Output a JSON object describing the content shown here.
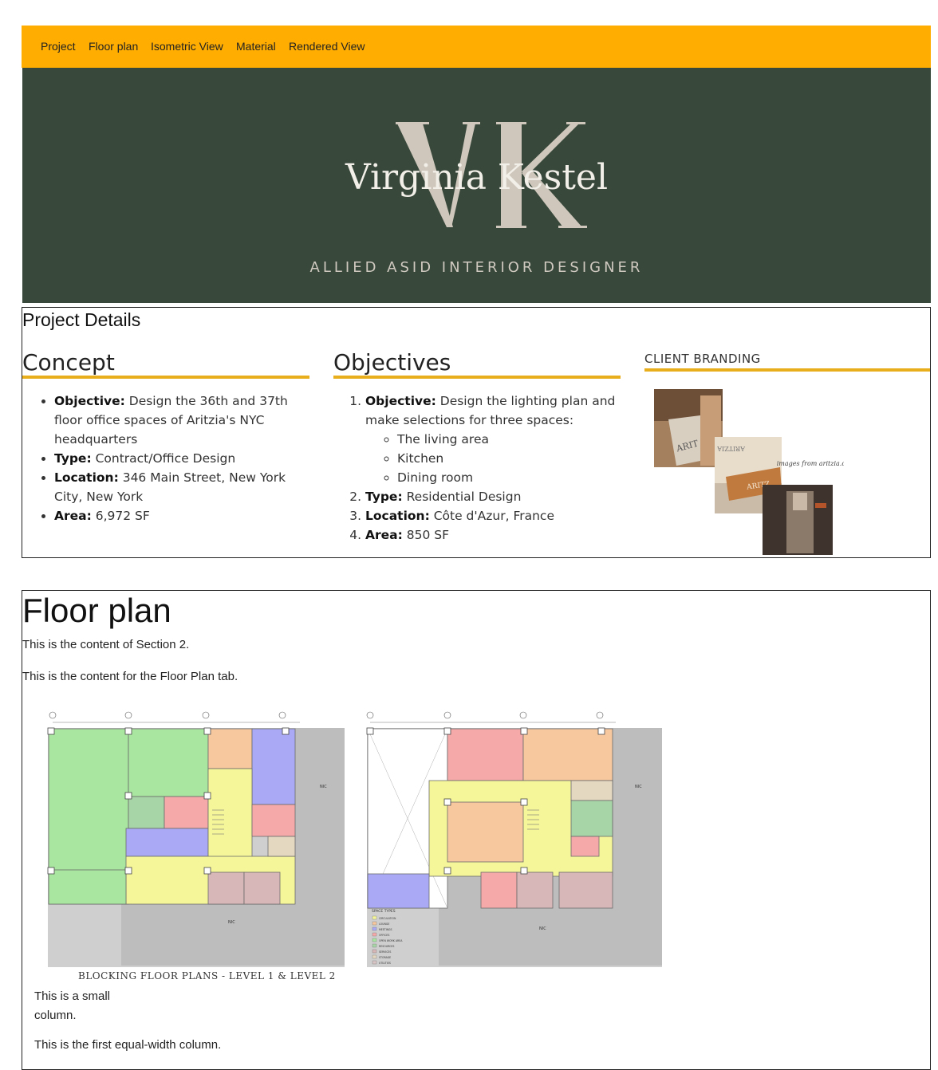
{
  "nav": {
    "items": [
      {
        "label": "Project"
      },
      {
        "label": "Floor plan"
      },
      {
        "label": "Isometric View"
      },
      {
        "label": "Material"
      },
      {
        "label": "Rendered View"
      }
    ]
  },
  "hero": {
    "monogram": "VK",
    "name": "Virginia Kestel",
    "subtitle": "ALLIED ASID INTERIOR DESIGNER"
  },
  "details": {
    "title": "Project Details",
    "concept": {
      "heading": "Concept",
      "items": [
        {
          "label": "Objective:",
          "text": " Design the 36th and 37th floor office spaces of Aritzia's NYC headquarters"
        },
        {
          "label": "Type:",
          "text": " Contract/Office Design"
        },
        {
          "label": "Location:",
          "text": " 346 Main Street, New York City, New York"
        },
        {
          "label": "Area:",
          "text": " 6,972 SF"
        }
      ]
    },
    "objectives": {
      "heading": "Objectives",
      "items": [
        {
          "label": "Objective:",
          "text": " Design the lighting plan and make selections for three spaces:"
        },
        {
          "label": "Type:",
          "text": " Residential Design"
        },
        {
          "label": "Location:",
          "text": " Côte d'Azur, France"
        },
        {
          "label": "Area:",
          "text": " 850 SF"
        }
      ],
      "spaces": [
        "The living area",
        "Kitchen",
        "Dining room"
      ]
    },
    "branding": {
      "heading": "CLIENT BRANDING",
      "note": "images from aritzia.com",
      "logo_text": "ARITZIA"
    }
  },
  "floorplan": {
    "heading": "Floor plan",
    "p1": "This is the content of Section 2.",
    "p2": "This is the content for the Floor Plan tab.",
    "caption": "BLOCKING FLOOR PLANS - LEVEL 1 & LEVEL 2",
    "small_col": "This is a small column.",
    "equal_col": "This is the first equal-width column.",
    "nic_label": "NIC",
    "legend_title": "SPACE TYPES",
    "legend": [
      {
        "label": "CIRCULATION",
        "color": "#F5F59A"
      },
      {
        "label": "LOUNGE",
        "color": "#F7C89E"
      },
      {
        "label": "MEETINGS",
        "color": "#A9A9F5"
      },
      {
        "label": "OFFICES",
        "color": "#F5A9A9"
      },
      {
        "label": "OPEN WORK AREA",
        "color": "#A9E6A0"
      },
      {
        "label": "RESOURCES",
        "color": "#A8D5A8"
      },
      {
        "label": "SERVICES",
        "color": "#D7B7B7"
      },
      {
        "label": "STORAGE",
        "color": "#E5D8C0"
      },
      {
        "label": "UTILITIES",
        "color": "#D8C5C5"
      }
    ]
  },
  "colors": {
    "nav_bg": "#FFAD01",
    "hero_bg": "#38483B",
    "accent_rule": "#E8AE1B"
  }
}
